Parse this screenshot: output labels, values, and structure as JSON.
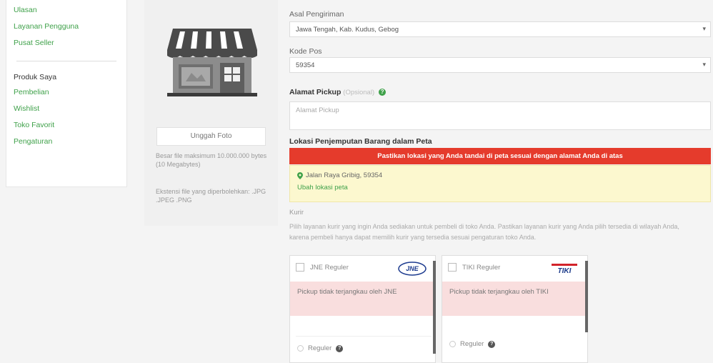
{
  "sidebar": {
    "top_links": [
      "Ulasan",
      "Layanan Pengguna",
      "Pusat Seller"
    ],
    "section_title": "Produk Saya",
    "section_links": [
      "Pembelian",
      "Wishlist",
      "Toko Favorit",
      "Pengaturan"
    ]
  },
  "store": {
    "upload_label": "Unggah Foto",
    "note1": "Besar file maksimum 10.000.000 bytes (10 Megabytes)",
    "note2": "Ekstensi file yang diperbolehkan: .JPG .JPEG .PNG"
  },
  "form": {
    "origin_label": "Asal Pengiriman",
    "origin_value": "Jawa Tengah, Kab. Kudus, Gebog",
    "postal_label": "Kode Pos",
    "postal_value": "59354",
    "pickup_label": "Alamat Pickup",
    "pickup_optional": "(Opsional)",
    "pickup_placeholder": "Alamat Pickup",
    "map_label": "Lokasi Penjemputan Barang dalam Peta",
    "alert_text": "Pastikan lokasi yang Anda tandai di peta sesuai dengan alamat Anda di atas",
    "location_text": "Jalan Raya Gribig, 59354",
    "location_link": "Ubah lokasi peta",
    "kurir_label": "Kurir",
    "kurir_desc_1": "Pilih layanan kurir yang ingin Anda sediakan untuk pembeli di toko Anda. Pastikan layanan kurir yang Anda pilih tersedia di wilayah Anda,",
    "kurir_desc_2": "karena pembeli hanya dapat memilih kurir yang tersedia sesuai pengaturan toko Anda."
  },
  "couriers": [
    {
      "name": "JNE Reguler",
      "logo": "JNE",
      "logo_color": "#1d3b8f",
      "alert": "Pickup tidak terjangkau oleh JNE",
      "service": "Reguler",
      "logo_text_color": "#1d3b8f"
    },
    {
      "name": "TIKI Reguler",
      "logo": "TIKI",
      "logo_color": "#d2232a",
      "alert": "Pickup tidak terjangkau oleh TIKI",
      "service": "Reguler",
      "logo_text_color": "#1b3a8a"
    }
  ],
  "colors": {
    "accent_green": "#3fa14a",
    "alert_red": "#e53b2c",
    "alert_yellow": "#fcf8cf"
  }
}
